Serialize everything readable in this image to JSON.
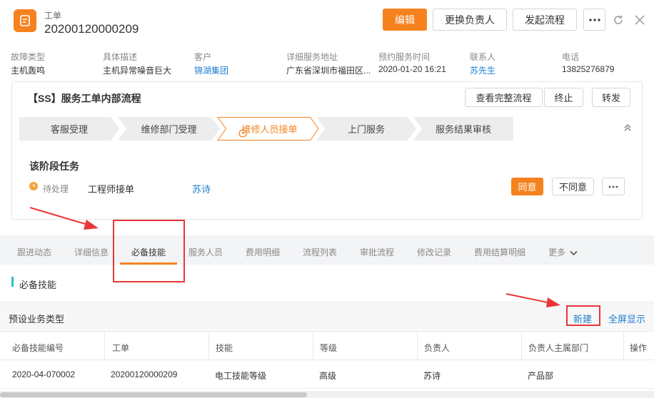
{
  "header": {
    "ticket_type": "工单",
    "ticket_no": "20200120000209",
    "buttons": {
      "edit": "编辑",
      "change_owner": "更换负责人",
      "start_flow": "发起流程"
    }
  },
  "info": {
    "fault_type": {
      "label": "故障类型",
      "value": "主机轰鸣"
    },
    "description": {
      "label": "具体描述",
      "value": "主机异常噪音巨大"
    },
    "customer": {
      "label": "客户",
      "value": "锦湖集团"
    },
    "address": {
      "label": "详细服务地址",
      "value": "广东省深圳市福田区..."
    },
    "appointment": {
      "label": "预约服务时间",
      "value": "2020-01-20 16:21"
    },
    "contact": {
      "label": "联系人",
      "value": "苏先生"
    },
    "phone": {
      "label": "电话",
      "value": "13825276879"
    }
  },
  "process": {
    "title": "【SS】服务工单内部流程",
    "buttons": {
      "view_full": "查看完整流程",
      "terminate": "终止",
      "forward": "转发"
    },
    "steps": [
      {
        "label": "客服受理",
        "state": "done"
      },
      {
        "label": "维修部门受理",
        "state": "done"
      },
      {
        "label": "维修人员接单",
        "state": "current"
      },
      {
        "label": "上门服务",
        "state": "pending"
      },
      {
        "label": "服务结果审核",
        "state": "pending"
      }
    ],
    "task_title": "该阶段任务",
    "task": {
      "status": "待处理",
      "name": "工程师接单",
      "assignee": "苏诗",
      "agree": "同意",
      "disagree": "不同意"
    }
  },
  "tabs": [
    "跟进动态",
    "详细信息",
    "必备技能",
    "服务人员",
    "费用明细",
    "流程列表",
    "审批流程",
    "修改记录",
    "费用结算明细",
    "更多"
  ],
  "active_tab": "必备技能",
  "section": {
    "title": "必备技能",
    "subhead": "预设业务类型",
    "new_label": "新建",
    "fullscreen_label": "全屏显示"
  },
  "table": {
    "columns": [
      "必备技能编号",
      "工单",
      "技能",
      "等级",
      "负责人",
      "负责人主属部门",
      "操作"
    ],
    "rows": [
      [
        "2020-04-070002",
        "20200120000209",
        "电工技能等级",
        "高级",
        "苏诗",
        "产品部",
        ""
      ]
    ]
  },
  "colors": {
    "accent": "#f5821f",
    "link": "#1f7fd0",
    "annotation": "#e8363a",
    "teal": "#21c4c4"
  },
  "icons": [
    "ticket-icon",
    "more-icon",
    "refresh-icon",
    "close-icon",
    "clock-icon",
    "chevron-up-icon",
    "chevron-down-icon"
  ]
}
